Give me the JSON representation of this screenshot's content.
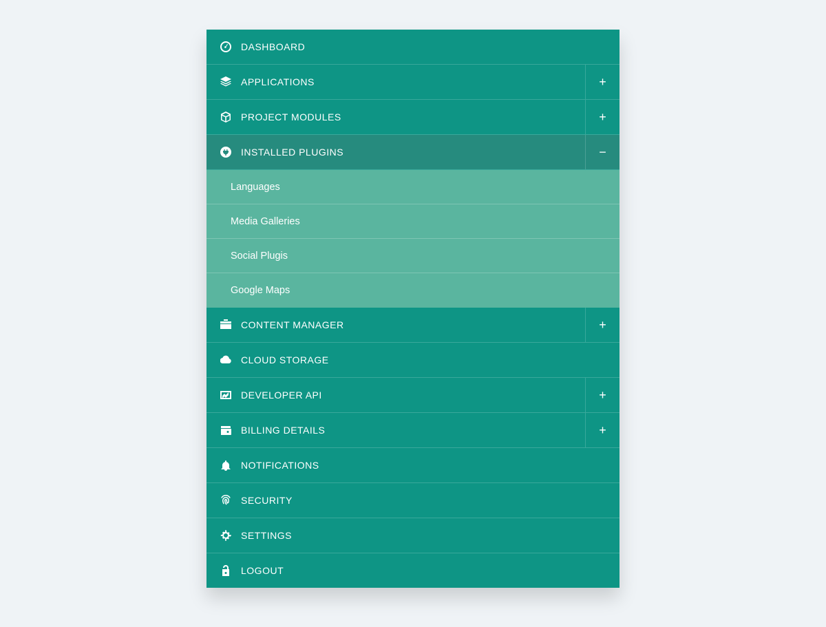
{
  "menu": {
    "items": [
      {
        "label": "DASHBOARD",
        "icon": "dashboard",
        "expandable": false,
        "expanded": false,
        "children": []
      },
      {
        "label": "APPLICATIONS",
        "icon": "layers",
        "expandable": true,
        "expanded": false,
        "children": []
      },
      {
        "label": "PROJECT MODULES",
        "icon": "cube",
        "expandable": true,
        "expanded": false,
        "children": []
      },
      {
        "label": "INSTALLED PLUGINS",
        "icon": "plug",
        "expandable": true,
        "expanded": true,
        "children": [
          {
            "label": "Languages"
          },
          {
            "label": "Media Galleries"
          },
          {
            "label": "Social Plugis"
          },
          {
            "label": "Google Maps"
          }
        ]
      },
      {
        "label": "CONTENT MANAGER",
        "icon": "briefcase",
        "expandable": true,
        "expanded": false,
        "children": []
      },
      {
        "label": "CLOUD STORAGE",
        "icon": "cloud",
        "expandable": false,
        "expanded": false,
        "children": []
      },
      {
        "label": "DEVELOPER API",
        "icon": "chart",
        "expandable": true,
        "expanded": false,
        "children": []
      },
      {
        "label": "BILLING DETAILS",
        "icon": "wallet",
        "expandable": true,
        "expanded": false,
        "children": []
      },
      {
        "label": "NOTIFICATIONS",
        "icon": "bell",
        "expandable": false,
        "expanded": false,
        "children": []
      },
      {
        "label": "SECURITY",
        "icon": "fingerprint",
        "expandable": false,
        "expanded": false,
        "children": []
      },
      {
        "label": "SETTINGS",
        "icon": "cog",
        "expandable": false,
        "expanded": false,
        "children": []
      },
      {
        "label": "LOGOUT",
        "icon": "unlock",
        "expandable": false,
        "expanded": false,
        "children": []
      }
    ]
  },
  "glyphs": {
    "plus": "+",
    "minus": "−"
  },
  "colors": {
    "bg": "#eff3f6",
    "primary": "#0e9585",
    "active": "#268b7e",
    "sub": "#5ab59f"
  }
}
